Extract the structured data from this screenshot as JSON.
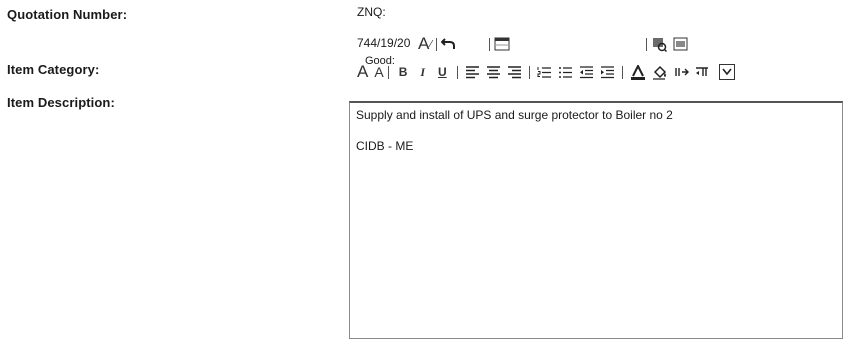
{
  "form": {
    "quotation_label": "Quotation Number:",
    "quotation_value_line1": "ZNQ:",
    "quotation_value_line2": "744/19/20",
    "category_label": "Item Category:",
    "category_value": "Good:",
    "description_label": "Item Description:",
    "description_lines": [
      "Supply and install of UPS and surge protector to Boiler no 2",
      "CIDB - ME"
    ]
  },
  "toolbar_top": {
    "icons": [
      "font-color-icon",
      "undo-icon",
      "insert-table-icon",
      "spellcheck-icon",
      "source-icon"
    ],
    "font_color_label": "A"
  },
  "toolbar_format": {
    "icons": [
      "increase-font-icon",
      "decrease-font-icon",
      "bold-icon",
      "italic-icon",
      "underline-icon",
      "align-left-icon",
      "align-center-icon",
      "align-right-icon",
      "numbered-list-icon",
      "bullet-list-icon",
      "outdent-icon",
      "indent-icon",
      "highlight-icon",
      "fill-color-icon",
      "ltr-icon",
      "rtl-icon",
      "expand-toolbar-icon"
    ],
    "bold_label": "B",
    "italic_label": "I",
    "underline_label": "U",
    "grow_label": "A",
    "shrink_label": "A"
  }
}
